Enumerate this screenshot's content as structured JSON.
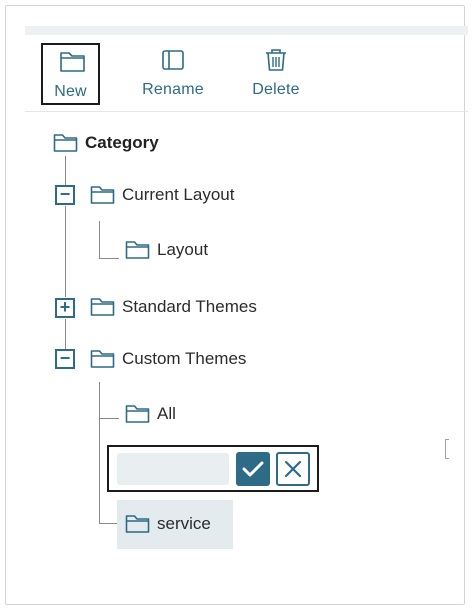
{
  "toolbar": {
    "new_label": "New",
    "rename_label": "Rename",
    "delete_label": "Delete"
  },
  "tree": {
    "root_label": "Category",
    "current_layout_label": "Current Layout",
    "layout_label": "Layout",
    "standard_themes_label": "Standard Themes",
    "custom_themes_label": "Custom Themes",
    "all_label": "All",
    "service_label": "service",
    "collapse_symbol": "−",
    "expand_symbol": "+"
  },
  "edit": {
    "value": ""
  },
  "colors": {
    "accent": "#2d6b86",
    "selected_bg": "#e3ebef",
    "input_bg": "#e9eef1"
  }
}
